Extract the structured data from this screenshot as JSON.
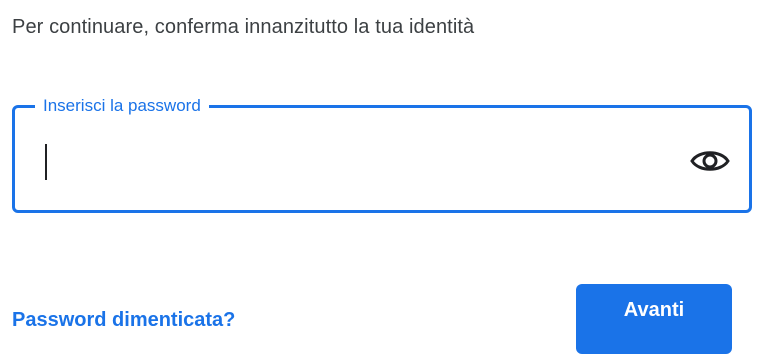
{
  "intro_text": "Per continuare, conferma innanzitutto la tua identità",
  "password_field": {
    "label": "Inserisci la password",
    "value": "",
    "show_password_icon": "eye-icon"
  },
  "forgot_link": "Password dimenticata?",
  "next_button": "Avanti",
  "colors": {
    "accent": "#1a73e8",
    "text": "#3c4043",
    "background": "#ffffff"
  }
}
